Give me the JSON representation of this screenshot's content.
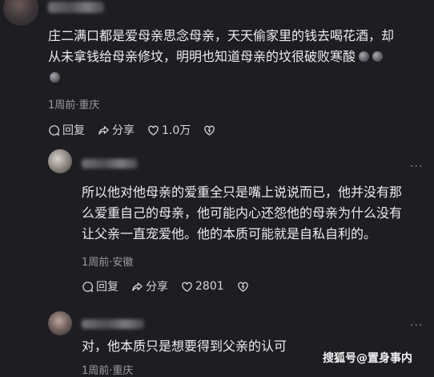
{
  "comments": [
    {
      "lines": [
        "庄二满口都是爱母亲思念母亲，天天偷家里的钱去喝花酒，却",
        "从未拿钱给母亲修坟，明明也知道母亲的坟很破败寒酸"
      ],
      "meta": "1周前·重庆",
      "actions": {
        "reply": "回复",
        "share": "分享",
        "like": "1.0万"
      }
    },
    {
      "lines": [
        "所以他对他母亲的爱重全只是嘴上说说而已，他并没有那",
        "么爱重自己的母亲，他可能内心还怨他的母亲为什么没有",
        "让父亲一直宠爱他。他的本质可能就是自私自利的。"
      ],
      "meta": "1周前·安徽",
      "actions": {
        "reply": "回复",
        "share": "分享",
        "like": "2801"
      }
    },
    {
      "lines": [
        "对，他本质只是想要得到父亲的认可"
      ],
      "meta": "1周前·重庆"
    }
  ],
  "more_glyph": "···",
  "watermark": "搜狐号@置身事内",
  "icons": [
    "reply-icon",
    "share-icon",
    "like-icon",
    "dislike-icon",
    "more-icon"
  ]
}
